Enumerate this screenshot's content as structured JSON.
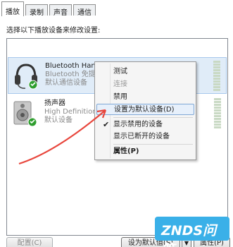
{
  "tabs": [
    "播放",
    "录制",
    "声音",
    "通信"
  ],
  "instruction": "选择以下播放设备来修改设置:",
  "devices": [
    {
      "name": "Bluetooth Hands-free Audio",
      "line2": "Bluetooth 免提音频设备",
      "line3": "默认通信设备",
      "icon": "headset-icon",
      "status": "default-communication"
    },
    {
      "name": "扬声器",
      "line2": "High Definition A",
      "line3": "默认设备",
      "icon": "speaker-icon",
      "status": "default"
    }
  ],
  "context_menu": {
    "items": [
      {
        "label": "测试",
        "enabled": true
      },
      {
        "label": "连接",
        "enabled": false
      },
      {
        "label": "禁用",
        "enabled": true
      },
      {
        "label": "设置为默认设备(D)",
        "enabled": true,
        "highlighted": true
      },
      {
        "label": "显示禁用的设备",
        "enabled": true,
        "checked": true
      },
      {
        "label": "显示已断开的设备",
        "enabled": true
      },
      {
        "label": "属性(P)",
        "enabled": true,
        "bold": true
      }
    ]
  },
  "buttons": {
    "configure": "配置(C)",
    "set_default": "设为默认值(S)",
    "properties": "属性(P)"
  },
  "watermark": "ZNDS问答",
  "colors": {
    "arrow": "#e8463c",
    "selection": "#e0ecf8",
    "watermark_bg": "#3ab0e8",
    "status_green": "#2f9e2f"
  }
}
